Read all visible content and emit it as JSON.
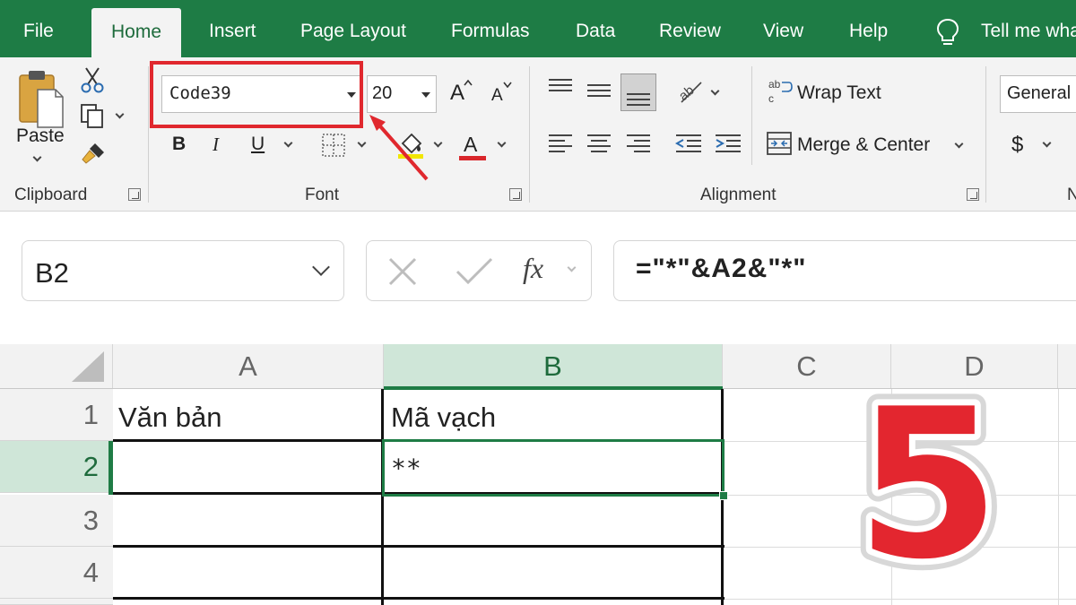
{
  "menu": {
    "tabs": [
      "File",
      "Home",
      "Insert",
      "Page Layout",
      "Formulas",
      "Data",
      "Review",
      "View",
      "Help"
    ],
    "tell_me": "Tell me wha"
  },
  "ribbon": {
    "clipboard": {
      "paste_label": "Paste",
      "group_label": "Clipboard"
    },
    "font": {
      "font_name": "Code39",
      "font_size": "20",
      "bold": "B",
      "italic": "I",
      "underline": "U",
      "grow": "A",
      "shrink": "A",
      "font_color_letter": "A",
      "group_label": "Font",
      "highlight_color": "#f1e600",
      "font_color": "#d9262b"
    },
    "alignment": {
      "wrap_text": "Wrap Text",
      "merge_center": "Merge & Center",
      "group_label": "Alignment"
    },
    "number": {
      "format": "General",
      "currency": "$",
      "group_label": "N"
    }
  },
  "formula_bar": {
    "name_box": "B2",
    "fx": "fx",
    "formula": "=\"*\"&A2&\"*\""
  },
  "grid": {
    "columns": [
      "A",
      "B",
      "C",
      "D"
    ],
    "rows": [
      "1",
      "2",
      "3",
      "4"
    ],
    "cells": {
      "A1": "Văn bản",
      "B1": "Mã vạch",
      "B2": "**"
    }
  },
  "overlay": {
    "step_number": "5"
  },
  "colors": {
    "accent_green": "#1e7c45",
    "selection_fill": "#cfe6d8",
    "annotation_red": "#e0282e"
  }
}
